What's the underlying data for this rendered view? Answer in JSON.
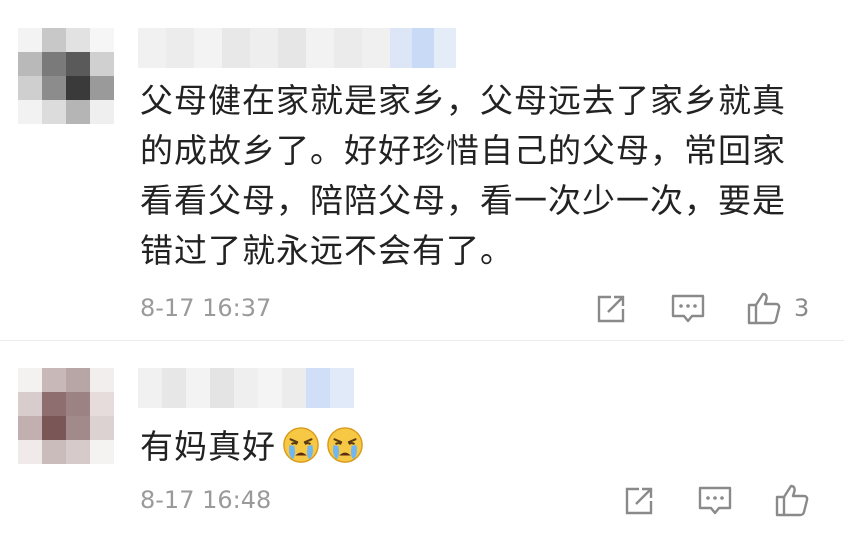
{
  "comments": [
    {
      "text": "父母健在家就是家乡，父母远去了家乡就真的成故乡了。好好珍惜自己的父母，常回家看看父母，陪陪父母，看一次少一次，要是错过了就永远不会有了。",
      "lines": [
        "父母健在家就是家乡，父母远去了家乡就真",
        "的成故乡了。好好珍惜自己的父母，常回家",
        "看看父母，陪陪父母，看一次少一次，要是",
        "错过了就永远不会有了。"
      ],
      "timestamp": "8-17 16:37",
      "like_count": "3"
    },
    {
      "text": "有妈真好",
      "emojis": [
        "crying-face-emoji",
        "crying-face-emoji"
      ],
      "timestamp": "8-17 16:48",
      "like_count": ""
    }
  ],
  "icons": [
    "share-icon",
    "comment-icon",
    "like-icon"
  ]
}
